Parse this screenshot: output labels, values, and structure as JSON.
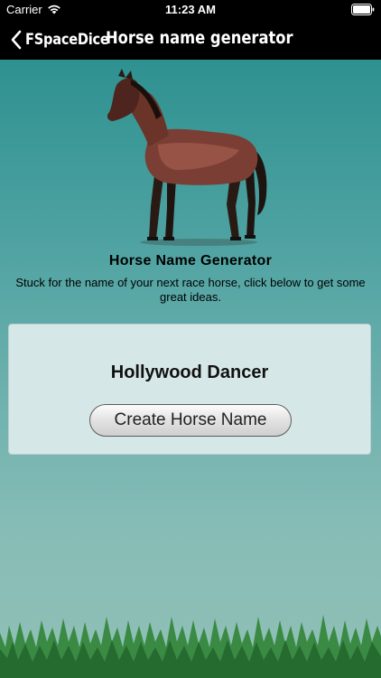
{
  "status_bar": {
    "carrier": "Carrier",
    "time": "11:23 AM"
  },
  "nav": {
    "back_label": "FSpaceDice",
    "title": "Horse name generator"
  },
  "generator": {
    "heading": "Horse Name Generator",
    "description": "Stuck for the name of your next race horse, click below to get some great ideas.",
    "generated_name": "Hollywood Dancer",
    "button_label": "Create Horse Name"
  },
  "icons": {
    "wifi": "wifi-icon",
    "battery": "battery-icon",
    "back": "chevron-left-icon"
  },
  "colors": {
    "bar_background": "#000000",
    "bg_top": "#2e9190",
    "bg_bottom": "#91c0b6",
    "card_background": "#d6e7e7",
    "grass": "#2f7a3a"
  }
}
